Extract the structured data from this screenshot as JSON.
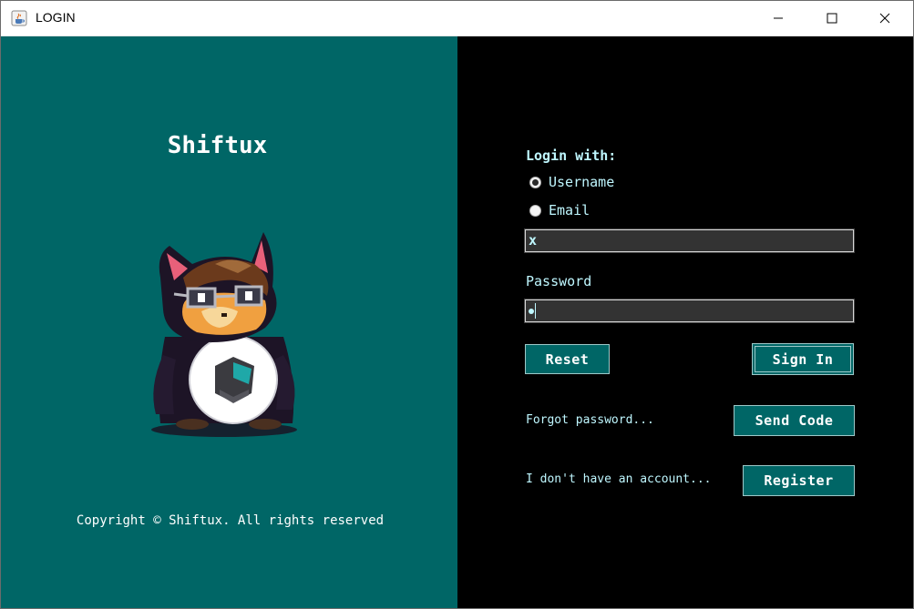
{
  "window": {
    "title": "LOGIN",
    "icons": {
      "app": "java-cup-icon",
      "minimize": "minimize-icon",
      "maximize": "maximize-icon",
      "close": "close-icon"
    }
  },
  "left": {
    "app_name": "Shiftux",
    "mascot": "cat-mascot-with-glasses",
    "copyright": "Copyright © Shiftux. All rights reserved"
  },
  "login": {
    "login_with_label": "Login with:",
    "options": [
      {
        "label": "Username",
        "selected": true
      },
      {
        "label": "Email",
        "selected": false
      }
    ],
    "username_value": "x",
    "password_label": "Password",
    "password_masked": true,
    "reset_label": "Reset",
    "signin_label": "Sign In",
    "forgot_text": "Forgot password...",
    "send_code_label": "Send Code",
    "no_account_text": "I don't have an account...",
    "register_label": "Register"
  },
  "colors": {
    "teal": "#006666",
    "text_cyan": "#bff7ff",
    "field_bg": "#333333",
    "background": "#000000"
  }
}
